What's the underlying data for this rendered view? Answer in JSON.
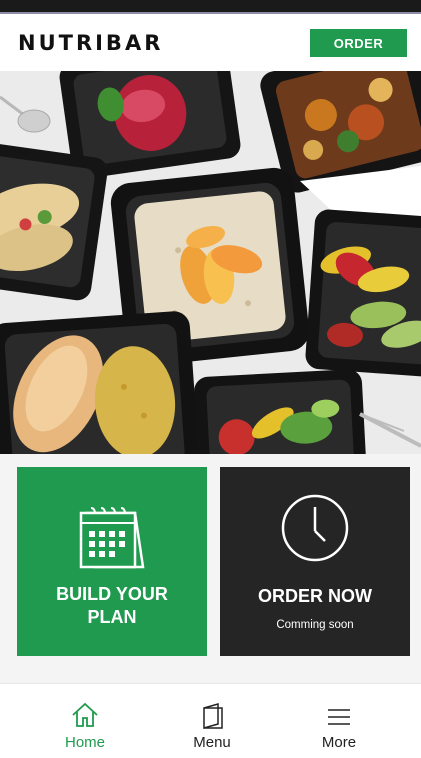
{
  "header": {
    "brand": "NUTRIBAR",
    "order_label": "ORDER"
  },
  "tiles": [
    {
      "title_line1": "BUILD YOUR",
      "title_line2": "PLAN",
      "subtitle": ""
    },
    {
      "title_line1": "ORDER NOW",
      "title_line2": "",
      "subtitle": "Comming soon"
    }
  ],
  "nav": {
    "items": [
      {
        "label": "Home",
        "icon": "home-icon",
        "active": true
      },
      {
        "label": "Menu",
        "icon": "menu-book-icon",
        "active": false
      },
      {
        "label": "More",
        "icon": "hamburger-icon",
        "active": false
      }
    ]
  },
  "colors": {
    "brand_green": "#1f9a4f",
    "dark_tile": "#252525"
  }
}
